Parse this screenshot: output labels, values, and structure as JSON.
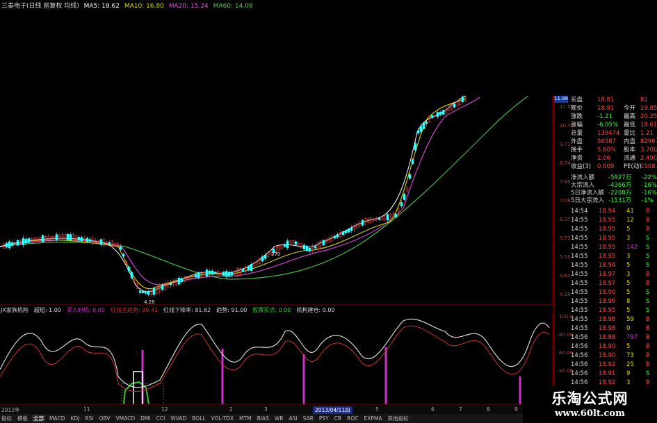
{
  "header": {
    "title": "三泰电子(日线 前复权 均线)",
    "ma5": "MA5: 18.62",
    "ma10": "MA10: 16.80",
    "ma20": "MA20: 15.24",
    "ma60": "MA60: 14.08"
  },
  "price_chart": {
    "right_axis": [
      "11.99",
      "10.79",
      "9.71",
      "8.74",
      "7.86",
      "7.08",
      "6.37",
      "5.73",
      "5.16",
      "4.64",
      "4.18"
    ],
    "annotations": {
      "low_label": "4.26",
      "mid_label": "270"
    }
  },
  "indicator": {
    "labels": [
      {
        "text": "JX家族机构",
        "color": "#dddddd"
      },
      {
        "text": "超短: 1.00",
        "color": "#dddddd"
      },
      {
        "text": "买入时机: 0.00",
        "color": "#cc33cc"
      },
      {
        "text": "红线主趋势: 90.41",
        "color": "#cc3333"
      },
      {
        "text": "红线下降率: 81.62",
        "color": "#cccccc"
      },
      {
        "text": "趋势: 91.00",
        "color": "#dddddd"
      },
      {
        "text": "股票买点: 0.00",
        "color": "#33cc33"
      },
      {
        "text": "机构建仓: 0.00",
        "color": "#dddddd"
      }
    ],
    "right_axis": [
      "100.0",
      "80.00",
      "60.00",
      "40.00"
    ]
  },
  "quote_panel": {
    "rows": [
      {
        "a": "买盘",
        "b": "18.81",
        "c": "",
        "d": "81"
      },
      {
        "a": "现价",
        "b": "18.91",
        "c": "今开",
        "d": "19.85"
      },
      {
        "a": "涨跌",
        "b": "-1.21",
        "c": "最高",
        "d": "20.25"
      },
      {
        "a": "涨幅",
        "b": "-6.05%",
        "c": "最低",
        "d": "18.61"
      },
      {
        "a": "总量",
        "b": "139474",
        "c": "量比",
        "d": "1.21"
      },
      {
        "a": "外盘",
        "b": "56587",
        "c": "内盘",
        "d": "82967"
      },
      {
        "a": "换手",
        "b": "5.60%",
        "c": "股本",
        "d": "3.70亿"
      },
      {
        "a": "净资",
        "b": "2.06",
        "c": "流通",
        "d": "2.49亿"
      },
      {
        "a": "收益(3)",
        "b": "0.009",
        "c": "PE(动)",
        "d": "1508.8"
      }
    ],
    "flows": [
      {
        "label": "净流入额",
        "v1": "-5927万",
        "v2": "-22%"
      },
      {
        "label": "大宗流入",
        "v1": "-4366万",
        "v2": "-16%"
      },
      {
        "label": "5日净流入额",
        "v1": "-2208万",
        "v2": "-16%"
      },
      {
        "label": "5日大宗流入",
        "v1": "-1531万",
        "v2": "-1%"
      }
    ],
    "ticks": [
      {
        "t": "14:54",
        "p": "18.94",
        "v": "41",
        "s": "B"
      },
      {
        "t": "14:55",
        "p": "18.95",
        "v": "12",
        "s": "B"
      },
      {
        "t": "14:55",
        "p": "18.95",
        "v": "5",
        "s": "B"
      },
      {
        "t": "14:55",
        "p": "18.95",
        "v": "3",
        "s": "S"
      },
      {
        "t": "14:55",
        "p": "18.95",
        "v": "142",
        "s": "S"
      },
      {
        "t": "14:55",
        "p": "18.95",
        "v": "3",
        "s": "S"
      },
      {
        "t": "14:55",
        "p": "18.94",
        "v": "5",
        "s": "S"
      },
      {
        "t": "14:55",
        "p": "18.97",
        "v": "3",
        "s": "B"
      },
      {
        "t": "14:55",
        "p": "18.97",
        "v": "5",
        "s": "B"
      },
      {
        "t": "14:55",
        "p": "18.96",
        "v": "5",
        "s": "S"
      },
      {
        "t": "14:55",
        "p": "18.96",
        "v": "8",
        "s": "S"
      },
      {
        "t": "14:55",
        "p": "18.95",
        "v": "5",
        "s": "S"
      },
      {
        "t": "14:55",
        "p": "18.98",
        "v": "59",
        "s": "B"
      },
      {
        "t": "14:55",
        "p": "18.98",
        "v": "0",
        "s": "B"
      },
      {
        "t": "14:56",
        "p": "18.88",
        "v": "797",
        "s": "B"
      },
      {
        "t": "14:56",
        "p": "18.90",
        "v": "5",
        "s": "B"
      },
      {
        "t": "14:56",
        "p": "18.90",
        "v": "73",
        "s": "B"
      },
      {
        "t": "14:56",
        "p": "18.92",
        "v": "25",
        "s": "B"
      },
      {
        "t": "14:56",
        "p": "18.91",
        "v": "9",
        "s": "S"
      },
      {
        "t": "14:56",
        "p": "18.92",
        "v": "3",
        "s": "B"
      },
      {
        "t": "14:56",
        "p": "18.91",
        "v": "5",
        "s": "S"
      },
      {
        "t": "14:56",
        "p": "18.91",
        "v": "9",
        "s": "S"
      }
    ]
  },
  "timeline": {
    "dates": [
      "2012年",
      "11",
      "12",
      "2",
      "3",
      "2013/04/11四",
      "5",
      "6",
      "7",
      "8",
      "9",
      "10",
      "11"
    ]
  },
  "tabs": [
    "指标",
    "模板",
    "全部",
    "MACD",
    "KDJ",
    "RSI",
    "OBV",
    "VMACD",
    "DMI",
    "CCI",
    "WVAD",
    "BOLL",
    "VOL-TDX",
    "MTM",
    "BIAS",
    "WR",
    "ASI",
    "SAR",
    "PSY",
    "CR",
    "ROC",
    "EXPMA",
    "其他指标"
  ],
  "watermark": {
    "line1": "乐淘公式网",
    "line2": "www.60lt.com"
  },
  "colors": {
    "up": "#ff3333",
    "down": "#33ffff",
    "grid": "#7a0000",
    "ma5": "#ffffff",
    "ma10": "#d8d800",
    "ma20": "#cc44cc",
    "ma60": "#44bb44"
  }
}
